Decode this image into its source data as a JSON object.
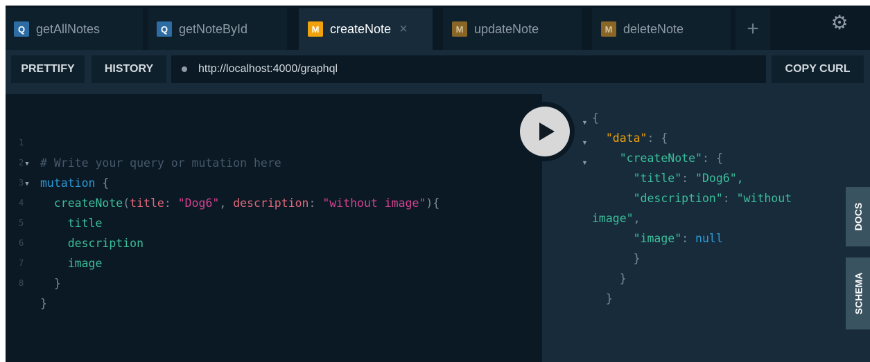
{
  "tabs": [
    {
      "badge": "Q",
      "label": "getAllNotes"
    },
    {
      "badge": "Q",
      "label": "getNoteById"
    },
    {
      "badge": "M",
      "label": "createNote",
      "close": "×"
    },
    {
      "badge": "M",
      "label": "updateNote"
    },
    {
      "badge": "M",
      "label": "deleteNote"
    }
  ],
  "tabbar": {
    "add": "+",
    "settings_icon": "gear-icon",
    "settings_glyph": "⚙"
  },
  "toolbar": {
    "prettify": "PRETTIFY",
    "history": "HISTORY",
    "endpoint": "http://localhost:4000/graphql",
    "copy_curl": "COPY CURL"
  },
  "editor": {
    "line_numbers": [
      "1",
      "2",
      "3",
      "4",
      "5",
      "6",
      "7",
      "8"
    ],
    "comment": "# Write your query or mutation here",
    "keyword": "mutation",
    "brace_open": "{",
    "field": "createNote",
    "paren_open": "(",
    "arg1_name": "title",
    "colon": ": ",
    "arg1_value": "\"Dog6\"",
    "comma": ", ",
    "arg2_name": "description",
    "arg2_value": "\"without image\"",
    "paren_close_brace": "){",
    "sel1": "title",
    "sel2": "description",
    "sel3": "image",
    "brace_close": "}"
  },
  "result": {
    "open": "{",
    "data_key": "\"data\"",
    "create_key": "\"createNote\"",
    "title_key": "\"title\"",
    "title_val": "\"Dog6\",",
    "desc_key": "\"description\"",
    "desc_val_start": "\"without",
    "desc_val_end": "image\"",
    "desc_comma": ",",
    "image_key": "\"image\"",
    "image_val": "null",
    "colon_brace": ": {",
    "colon": ": ",
    "close": "}"
  },
  "side": {
    "docs": "DOCS",
    "schema": "SCHEMA"
  },
  "colors": {
    "background": "#0f202d",
    "query_badge": "#2e6da4",
    "mutation_badge": "#f0a20c",
    "string_value": "#3cbf9b"
  }
}
